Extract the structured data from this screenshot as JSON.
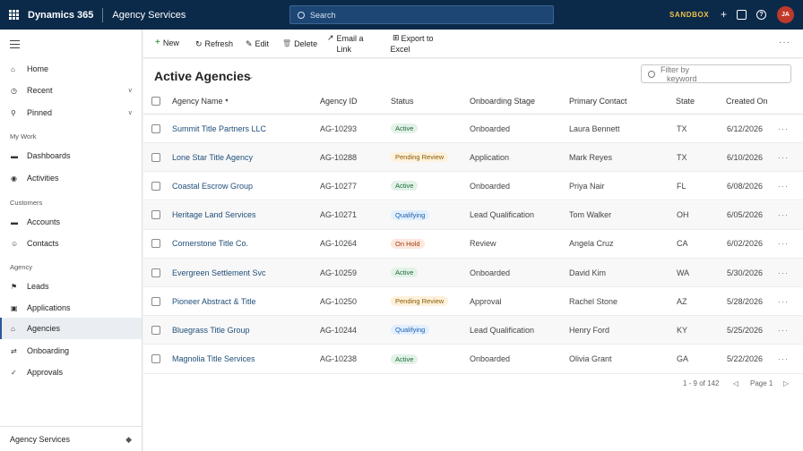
{
  "topbar": {
    "brand": "Dynamics 365",
    "app_name": "Agency Services",
    "search_placeholder": "Search",
    "environment": "SANDBOX",
    "avatar_initials": "JA",
    "help": "?",
    "plus": "+"
  },
  "sidebar": {
    "items": [
      {
        "label": "Home",
        "icon": "home-icon",
        "glyph": "⌂"
      },
      {
        "label": "Recent",
        "icon": "clock-icon",
        "glyph": "◷",
        "chev": "v"
      },
      {
        "label": "Pinned",
        "icon": "pin-icon",
        "glyph": "⚲",
        "chev": "v"
      }
    ],
    "group_mywork": "My Work",
    "mywork": [
      {
        "label": "Dashboards",
        "glyph": "▬"
      },
      {
        "label": "Activities",
        "glyph": "◉"
      }
    ],
    "group_customers": "Customers",
    "customers": [
      {
        "label": "Accounts",
        "glyph": "▬"
      },
      {
        "label": "Contacts",
        "glyph": "☺"
      }
    ],
    "group_agency": "Agency",
    "agency": [
      {
        "label": "Leads",
        "glyph": "⚑"
      },
      {
        "label": "Applications",
        "glyph": "▣"
      },
      {
        "label": "Agencies",
        "glyph": "⌂"
      },
      {
        "label": "Onboarding",
        "glyph": "⇄"
      },
      {
        "label": "Approvals",
        "glyph": "✓"
      }
    ],
    "area": "Agency Services",
    "area_glyph": "◆"
  },
  "commands": {
    "new_glyph": "+",
    "new": "New",
    "refresh_glyph": "↻",
    "refresh": "Refresh",
    "edit_glyph": "✎",
    "edit": "Edit",
    "delete_glyph": "🗑",
    "delete": "Delete",
    "email_glyph": "↗",
    "email_1": "Email a",
    "email_2": "Link",
    "export_glyph": "⊞",
    "export_1": "Export to",
    "export_2": "Excel",
    "more": "···"
  },
  "view": {
    "title": "Active Agencies",
    "chev": "⌄",
    "filter_placeholder_1": "Filter by",
    "filter_placeholder_2": "keyword"
  },
  "columns": {
    "name": "Agency Name",
    "name_sort": "▾",
    "id": "Agency ID",
    "status": "Status",
    "stage": "Onboarding Stage",
    "contact": "Primary Contact",
    "state": "State",
    "created": "Created On"
  },
  "rows": [
    {
      "name": "Summit Title Partners LLC",
      "id": "AG-10293",
      "status": "Active",
      "stage": "Onboarded",
      "contact": "Laura Bennett",
      "state": "TX",
      "created": "6/12/2026",
      "more": "···"
    },
    {
      "name": "Lone Star Title Agency",
      "id": "AG-10288",
      "status": "Pending Review",
      "stage": "Application",
      "contact": "Mark Reyes",
      "state": "TX",
      "created": "6/10/2026",
      "more": "···"
    },
    {
      "name": "Coastal Escrow Group",
      "id": "AG-10277",
      "status": "Active",
      "stage": "Onboarded",
      "contact": "Priya Nair",
      "state": "FL",
      "created": "6/08/2026",
      "more": "···"
    },
    {
      "name": "Heritage Land Services",
      "id": "AG-10271",
      "status": "Qualifying",
      "stage": "Lead Qualification",
      "contact": "Tom Walker",
      "state": "OH",
      "created": "6/05/2026",
      "more": "···"
    },
    {
      "name": "Cornerstone Title Co.",
      "id": "AG-10264",
      "status": "On Hold",
      "stage": "Review",
      "contact": "Angela Cruz",
      "state": "CA",
      "created": "6/02/2026",
      "more": "···"
    },
    {
      "name": "Evergreen Settlement Svc",
      "id": "AG-10259",
      "status": "Active",
      "stage": "Onboarded",
      "contact": "David Kim",
      "state": "WA",
      "created": "5/30/2026",
      "more": "···"
    },
    {
      "name": "Pioneer Abstract & Title",
      "id": "AG-10250",
      "status": "Pending Review",
      "stage": "Approval",
      "contact": "Rachel Stone",
      "state": "AZ",
      "created": "5/28/2026",
      "more": "···"
    },
    {
      "name": "Bluegrass Title Group",
      "id": "AG-10244",
      "status": "Qualifying",
      "stage": "Lead Qualification",
      "contact": "Henry Ford",
      "state": "KY",
      "created": "5/25/2026",
      "more": "···"
    },
    {
      "name": "Magnolia Title Services",
      "id": "AG-10238",
      "status": "Active",
      "stage": "Onboarded",
      "contact": "Olivia Grant",
      "state": "GA",
      "created": "5/22/2026",
      "more": "···"
    }
  ],
  "pager": {
    "range": "1 - 9 of 142",
    "prev": "◁",
    "page": "Page 1",
    "next": "▷"
  }
}
